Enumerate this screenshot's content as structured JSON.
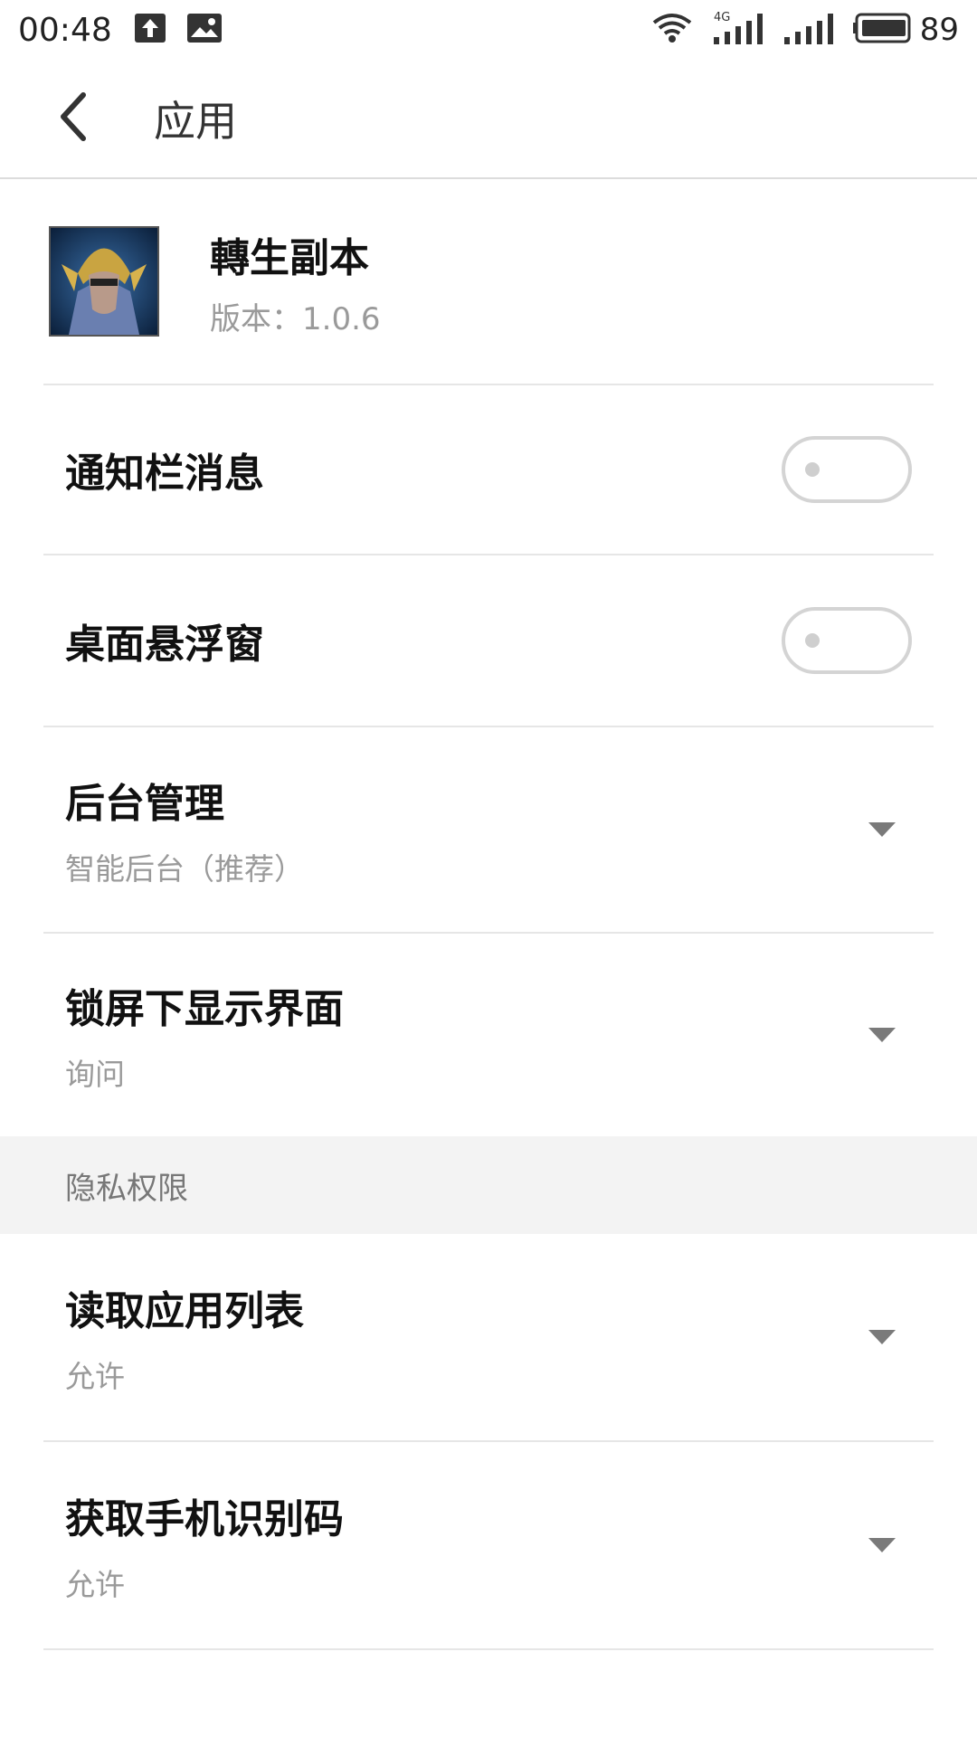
{
  "status_bar": {
    "time": "00:48",
    "network": "4G",
    "battery": "89",
    "icons": [
      "upload-icon",
      "image-notification-icon",
      "wifi-icon",
      "signal-4g-icon",
      "signal-icon",
      "battery-icon"
    ]
  },
  "header": {
    "title": "应用",
    "back_icon": "back-arrow-icon"
  },
  "app": {
    "name": "轉生副本",
    "version_label": "版本：",
    "version": "1.0.6"
  },
  "settings": [
    {
      "title": "通知栏消息",
      "control": "toggle",
      "on": false
    },
    {
      "title": "桌面悬浮窗",
      "control": "toggle",
      "on": false
    },
    {
      "title": "后台管理",
      "value": "智能后台（推荐）",
      "control": "dropdown"
    },
    {
      "title": "锁屏下显示界面",
      "value": "询问",
      "control": "dropdown"
    }
  ],
  "privacy_section": {
    "header": "隐私权限",
    "items": [
      {
        "title": "读取应用列表",
        "value": "允许",
        "control": "dropdown"
      },
      {
        "title": "获取手机识别码",
        "value": "允许",
        "control": "dropdown"
      }
    ]
  },
  "colors": {
    "divider": "#e6e6e6",
    "section_bg": "#f3f3f3",
    "secondary_text": "#9a9a9a"
  }
}
